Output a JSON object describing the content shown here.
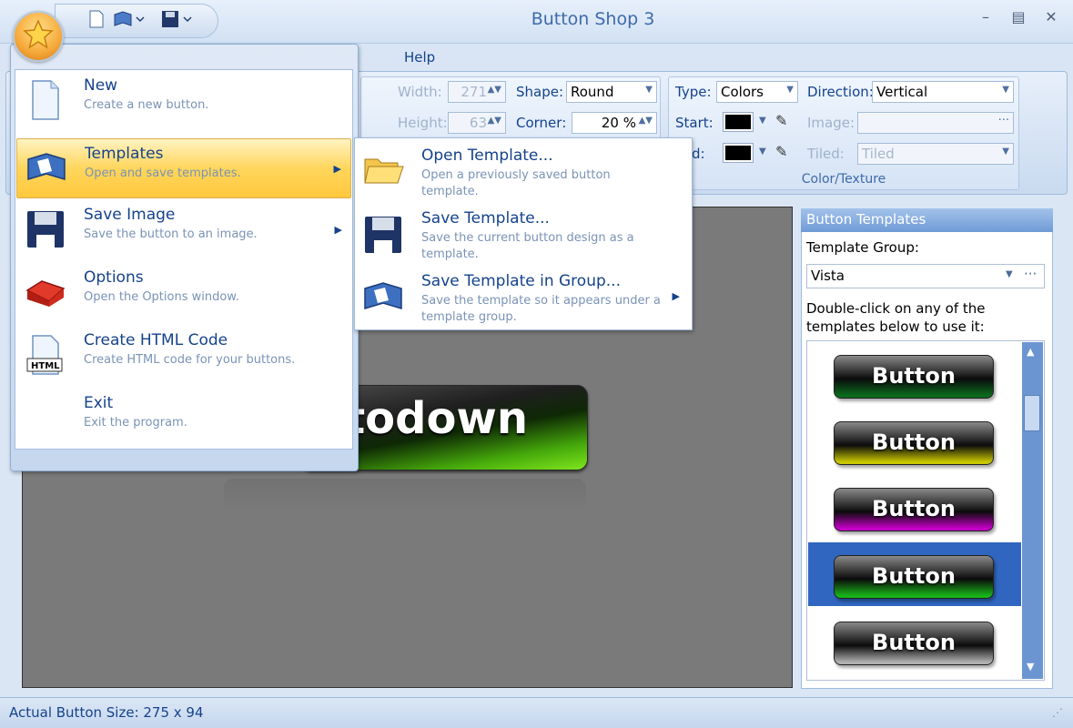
{
  "window": {
    "title": "Button Shop 3",
    "controls": [
      "minimize",
      "maximize",
      "close"
    ]
  },
  "quick_access": {
    "icons": [
      "new-icon",
      "templates-icon",
      "save-icon"
    ]
  },
  "ribbon": {
    "tabs": [
      "Help"
    ],
    "size": {
      "width_label": "Width:",
      "width_value": "271",
      "height_label": "Height:",
      "height_value": "63"
    },
    "shape": {
      "shape_label": "Shape:",
      "shape_value": "Round",
      "corner_label": "Corner:",
      "corner_value": "20 %"
    },
    "color_texture": {
      "group_label": "Color/Texture",
      "type_label": "Type:",
      "type_value": "Colors",
      "start_label": "Start:",
      "start_color": "#000000",
      "end_label": "d:",
      "end_color": "#000000",
      "direction_label": "Direction:",
      "direction_value": "Vertical",
      "image_label": "Image:",
      "image_value": "",
      "tiled_label": "Tiled:",
      "tiled_value": "Tiled"
    }
  },
  "canvas": {
    "preview_text": "todown"
  },
  "templates_panel": {
    "title": "Button Templates",
    "group_label": "Template Group:",
    "group_value": "Vista",
    "more_label": "···",
    "instructions": "Double-click on any of the templates below to use it:",
    "items": [
      {
        "label": "Button",
        "color": "#0b6a1c",
        "selected": false
      },
      {
        "label": "Button",
        "color": "#c9c700",
        "selected": false
      },
      {
        "label": "Button",
        "color": "#c400c7",
        "selected": false
      },
      {
        "label": "Button",
        "color": "#18b318",
        "selected": true
      },
      {
        "label": "Button",
        "color": "#b0b0b0",
        "selected": false
      }
    ]
  },
  "app_menu": {
    "items": [
      {
        "title": "New",
        "desc": "Create a new button.",
        "icon": "new-document-icon",
        "has_submenu": false
      },
      {
        "title": "Templates",
        "desc": "Open and save templates.",
        "icon": "templates-book-icon",
        "has_submenu": true
      },
      {
        "title": "Save Image",
        "desc": "Save the button to an image.",
        "icon": "floppy-disk-icon",
        "has_submenu": true
      },
      {
        "title": "Options",
        "desc": "Open the Options window.",
        "icon": "toolbox-icon",
        "has_submenu": false
      },
      {
        "title": "Create HTML Code",
        "desc": "Create HTML code for your buttons.",
        "icon": "html-file-icon",
        "has_submenu": false
      },
      {
        "title": "Exit",
        "desc": "Exit the program.",
        "icon": "",
        "has_submenu": false
      }
    ]
  },
  "templates_submenu": {
    "items": [
      {
        "title": "Open Template...",
        "desc": "Open a previously saved button template.",
        "icon": "folder-open-icon"
      },
      {
        "title": "Save Template...",
        "desc": "Save the current button design as a template.",
        "icon": "floppy-disk-icon"
      },
      {
        "title": "Save Template in Group...",
        "desc": "Save the template so it appears under a template group.",
        "icon": "templates-book-icon"
      }
    ]
  },
  "status_bar": {
    "text": "Actual Button Size:  275 x 94"
  }
}
